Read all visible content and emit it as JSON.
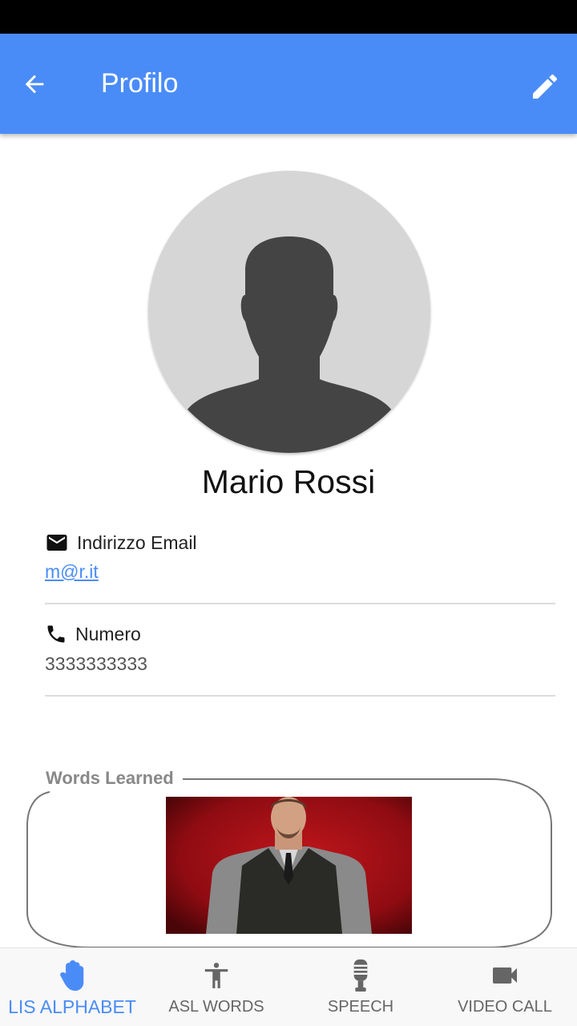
{
  "app_bar": {
    "title": "Profilo"
  },
  "profile": {
    "name": "Mario Rossi",
    "email_label": "Indirizzo Email",
    "email_value": "m@r.it",
    "phone_label": "Numero",
    "phone_value": "3333333333"
  },
  "words_learned": {
    "label": "Words Learned"
  },
  "bottom_nav": {
    "items": [
      {
        "label": "LIS ALPHABET",
        "icon": "hand-icon",
        "active": true
      },
      {
        "label": "ASL WORDS",
        "icon": "accessibility-icon",
        "active": false
      },
      {
        "label": "SPEECH",
        "icon": "microphone-icon",
        "active": false
      },
      {
        "label": "VIDEO CALL",
        "icon": "videocam-icon",
        "active": false
      }
    ]
  },
  "colors": {
    "primary": "#4a8cf7",
    "status_bar": "#000000",
    "nav_inactive": "#666666"
  }
}
